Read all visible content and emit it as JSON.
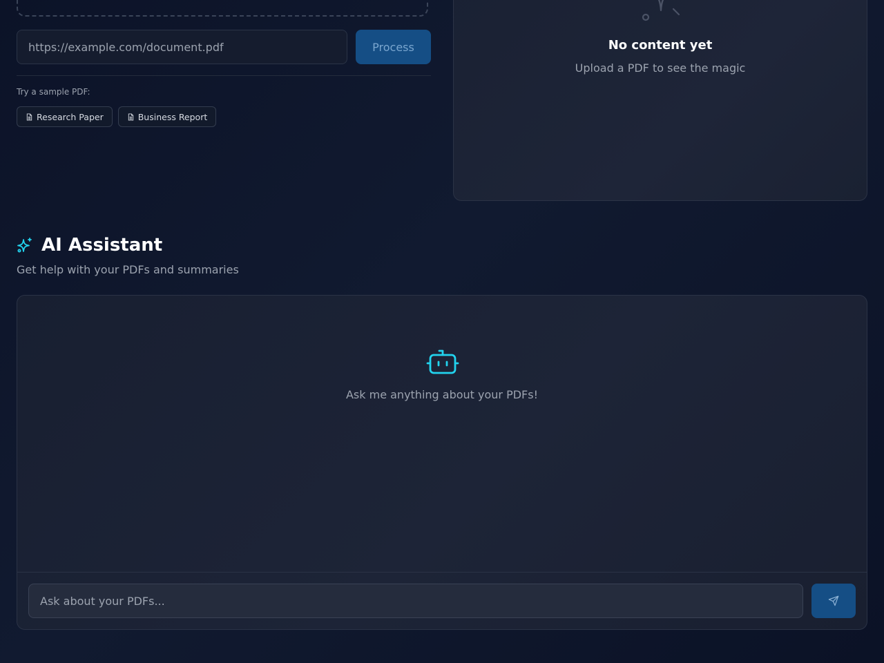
{
  "upload": {
    "url_placeholder": "https://example.com/document.pdf",
    "process_label": "Process",
    "sample_label": "Try a sample PDF:",
    "samples": [
      {
        "label": "Research Paper",
        "icon": "file-icon"
      },
      {
        "label": "Business Report",
        "icon": "file-icon"
      }
    ]
  },
  "output": {
    "icon": "sparkle-icon",
    "empty_title": "No content yet",
    "empty_subtitle": "Upload a PDF to see the magic"
  },
  "assistant": {
    "icon": "sparkles-icon",
    "title": "AI Assistant",
    "subtitle": "Get help with your PDFs and summaries",
    "empty_icon": "robot-icon",
    "empty_message": "Ask me anything about your PDFs!",
    "input_placeholder": "Ask about your PDFs...",
    "send_icon": "send-icon"
  },
  "colors": {
    "background": "#0b1124",
    "accent": "#22d3ee",
    "button": "#154e85",
    "card": "#1c2335"
  }
}
